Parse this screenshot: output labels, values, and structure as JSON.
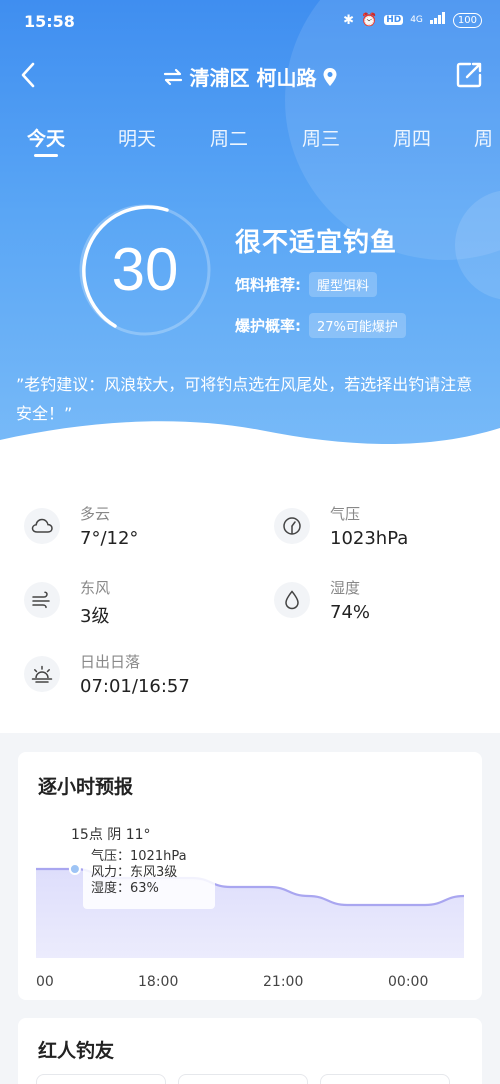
{
  "status_bar": {
    "time": "15:58",
    "battery": "100",
    "network": "4G"
  },
  "nav": {
    "location": "清浦区 柯山路"
  },
  "tabs": [
    "今天",
    "明天",
    "周二",
    "周三",
    "周四",
    "周"
  ],
  "summary": {
    "score": "30",
    "verdict": "很不适宜钓鱼",
    "bait_label": "饵料推荐:",
    "bait_value": "腥型饵料",
    "bite_label": "爆护概率:",
    "bite_value": "27%可能爆护",
    "advice": "”老钓建议：风浪较大，可将钓点选在风尾处，若选择出钓请注意安全！”"
  },
  "details": [
    {
      "icon": "cloud-icon",
      "label": "多云",
      "value": "7°/12°"
    },
    {
      "icon": "pressure-icon",
      "label": "气压",
      "value": "1023hPa"
    },
    {
      "icon": "wind-icon",
      "label": "东风",
      "value": "3级"
    },
    {
      "icon": "drop-icon",
      "label": "湿度",
      "value": "74%"
    },
    {
      "icon": "sunrise-icon",
      "label": "日出日落",
      "value": "07:01/16:57"
    }
  ],
  "hourly": {
    "title": "逐小时预报",
    "tooltip_title": "15点 阴 11°",
    "tooltip_lines": [
      "气压：1021hPa",
      "风力：东风3级",
      "湿度：63%"
    ],
    "x_labels": [
      "00",
      "18:00",
      "21:00",
      "00:00"
    ]
  },
  "chart_data": {
    "type": "area",
    "series": [
      {
        "values": [
          1022,
          1022,
          1021,
          1021,
          1021,
          1020,
          1020,
          1019,
          1018,
          1018,
          1018,
          1019
        ]
      }
    ],
    "highlight_index": 1
  },
  "friends": {
    "title": "红人钓友"
  },
  "colors": {
    "hero_top": "#3f8ef0",
    "hero_bottom": "#7bbcf8",
    "chart_line": "#a9a6f0",
    "chart_fill": "#dcdcfb"
  }
}
